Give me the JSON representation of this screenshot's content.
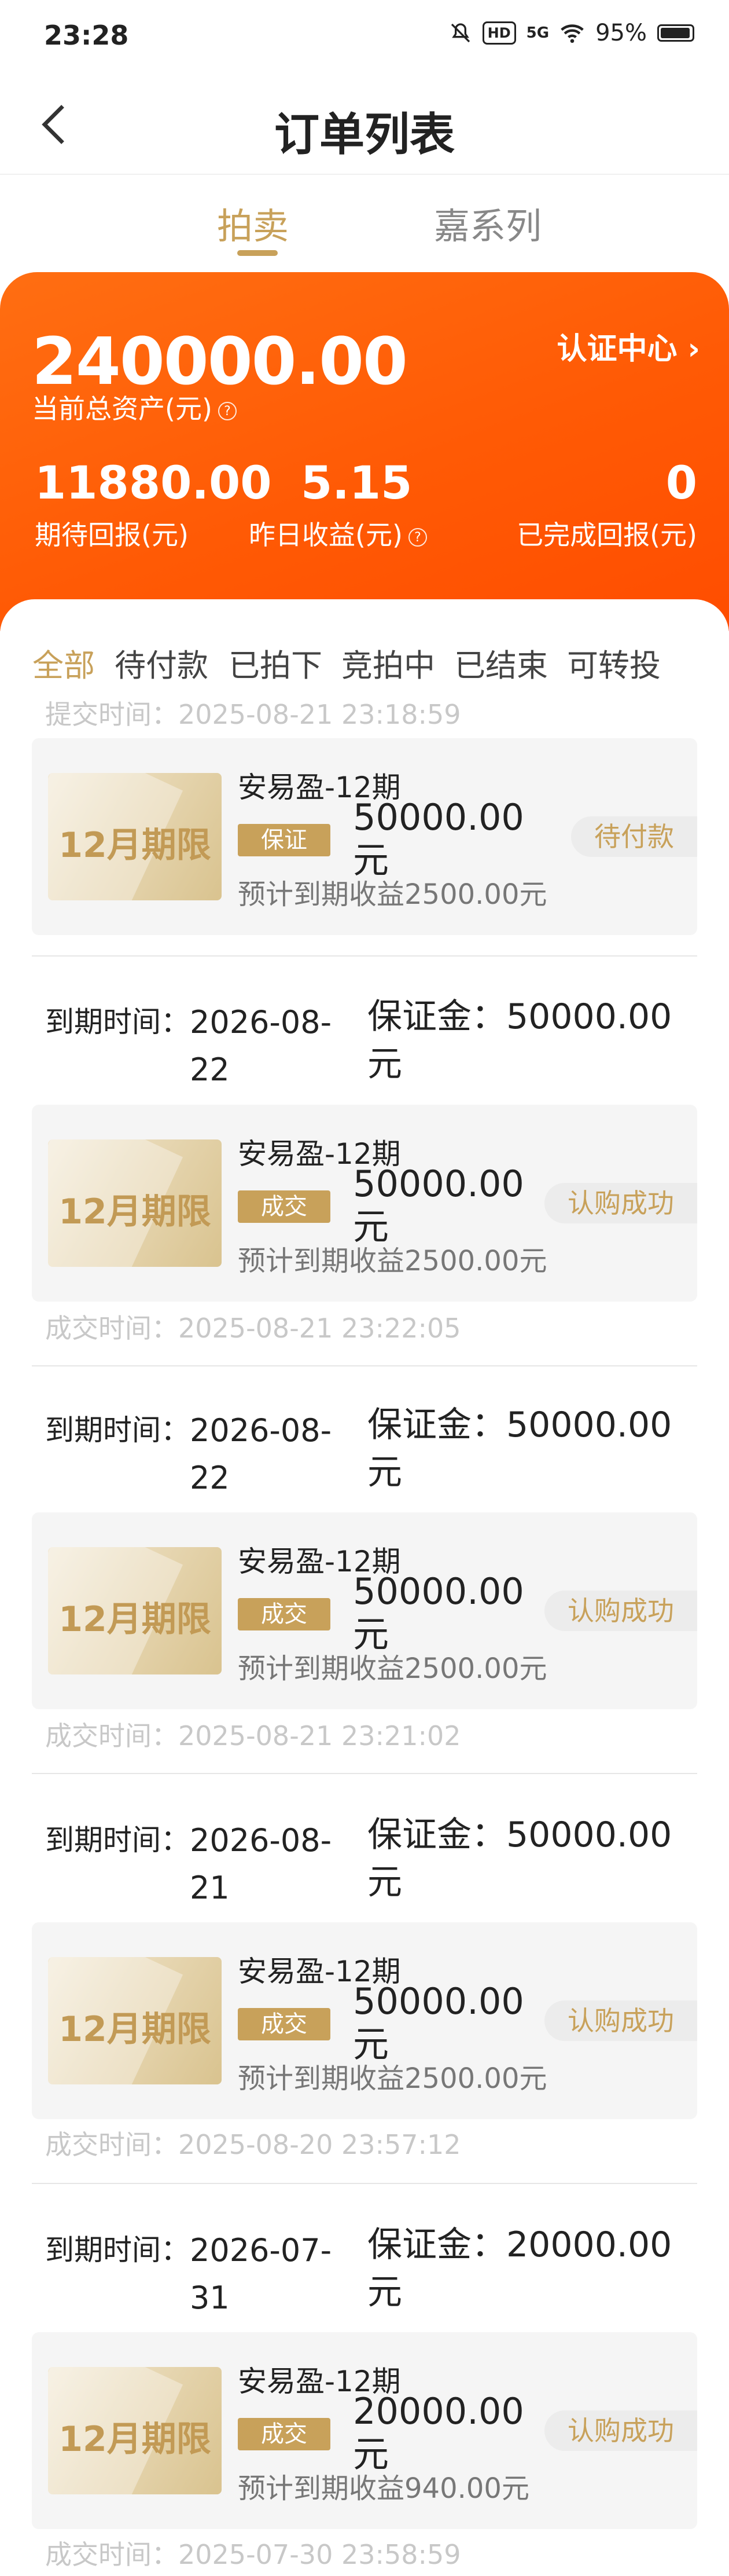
{
  "status_bar": {
    "time": "23:28",
    "signal": "5G",
    "battery": "95%"
  },
  "nav": {
    "title": "订单列表"
  },
  "tabs": [
    {
      "label": "拍卖"
    },
    {
      "label": "嘉系列"
    }
  ],
  "assets": {
    "total": "240000.00",
    "total_label": "当前总资产(元)",
    "cert_label": "认证中心 ›",
    "stats": [
      {
        "value": "11880.00",
        "label": "期待回报(元)"
      },
      {
        "value": "5.15",
        "label": "昨日收益(元)"
      },
      {
        "value": "0",
        "label": "已完成回报(元)"
      }
    ]
  },
  "filters": [
    "全部",
    "待付款",
    "已拍下",
    "竞拍中",
    "已结束",
    "可转投"
  ],
  "orders": [
    {
      "submit_text": "提交时间：2025-08-21 23:18:59",
      "thumb": "12月期限",
      "name": "安易盈-12期",
      "badge": "保证",
      "amount": "50000.00 元",
      "expect": "预计到期收益2500.00元",
      "status": "待付款"
    },
    {
      "due_label": "到期时间：",
      "due_date": "2026-08-22",
      "deposit_label": "保证金：",
      "deposit": "50000.00 元",
      "thumb": "12月期限",
      "name": "安易盈-12期",
      "badge": "成交",
      "amount": "50000.00 元",
      "expect": "预计到期收益2500.00元",
      "status": "认购成功",
      "deal_text": "成交时间：2025-08-21 23:22:05"
    },
    {
      "due_label": "到期时间：",
      "due_date": "2026-08-22",
      "deposit_label": "保证金：",
      "deposit": "50000.00 元",
      "thumb": "12月期限",
      "name": "安易盈-12期",
      "badge": "成交",
      "amount": "50000.00 元",
      "expect": "预计到期收益2500.00元",
      "status": "认购成功",
      "deal_text": "成交时间：2025-08-21 23:21:02"
    },
    {
      "due_label": "到期时间：",
      "due_date": "2026-08-21",
      "deposit_label": "保证金：",
      "deposit": "50000.00 元",
      "thumb": "12月期限",
      "name": "安易盈-12期",
      "badge": "成交",
      "amount": "50000.00 元",
      "expect": "预计到期收益2500.00元",
      "status": "认购成功",
      "deal_text": "成交时间：2025-08-20 23:57:12"
    },
    {
      "due_label": "到期时间：",
      "due_date": "2026-07-31",
      "deposit_label": "保证金：",
      "deposit": "20000.00 元",
      "thumb": "12月期限",
      "name": "安易盈-12期",
      "badge": "成交",
      "amount": "20000.00 元",
      "expect": "预计到期收益940.00元",
      "status": "认购成功",
      "deal_text": "成交时间：2025-07-30 23:58:59"
    }
  ]
}
